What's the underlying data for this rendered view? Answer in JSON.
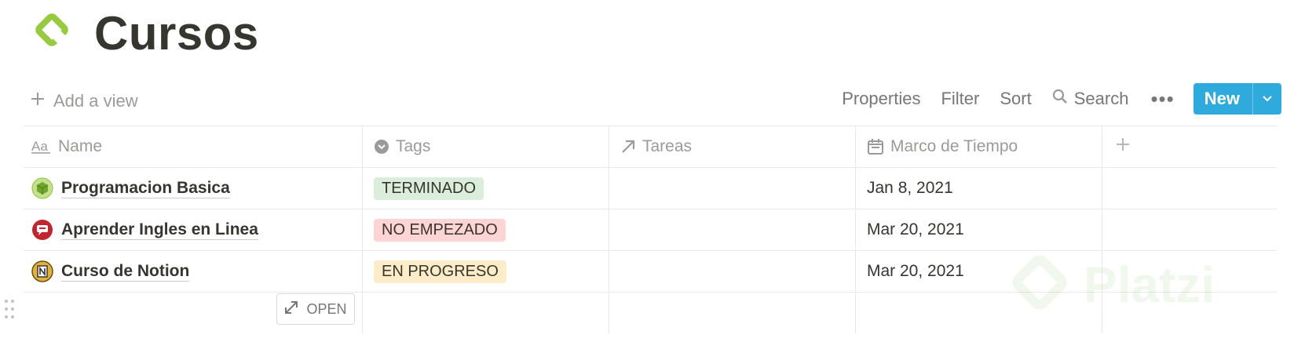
{
  "page": {
    "title": "Cursos"
  },
  "toolbar": {
    "add_view": "Add a view",
    "properties": "Properties",
    "filter": "Filter",
    "sort": "Sort",
    "search": "Search",
    "new": "New"
  },
  "table": {
    "columns": [
      "Name",
      "Tags",
      "Tareas",
      "Marco de Tiempo"
    ],
    "rows": [
      {
        "name": "Programacion Basica",
        "tag": "TERMINADO",
        "tareas": "",
        "date": "Jan 8, 2021"
      },
      {
        "name": "Aprender Ingles en Linea",
        "tag": "NO EMPEZADO",
        "tareas": "",
        "date": "Mar 20, 2021"
      },
      {
        "name": "Curso de Notion",
        "tag": "EN PROGRESO",
        "tareas": "",
        "date": "Mar 20, 2021"
      }
    ],
    "open_button": "OPEN"
  },
  "watermark": {
    "text": "Platzi"
  },
  "colors": {
    "accent_blue": "#2eaadc",
    "tag_terminado_bg": "#dbeddb",
    "tag_no_empezado_bg": "#ffd4d4",
    "tag_en_progreso_bg": "#fdecc8",
    "platzi_green": "#98ca3f"
  },
  "icons": {
    "page": "platzi-logo-icon",
    "add_view": "plus-icon",
    "search": "search-icon",
    "more": "more-dots-icon",
    "new_dropdown": "chevron-down-icon",
    "name_column": "text-aa-icon",
    "tags_column": "select-chevron-icon",
    "tareas_column": "relation-arrow-icon",
    "date_column": "calendar-icon",
    "add_column": "plus-icon",
    "row_icons": [
      "green-cube-icon",
      "red-speech-bubble-icon",
      "notion-logo-icon"
    ],
    "open": "expand-icon",
    "drag": "drag-handle-icon"
  }
}
